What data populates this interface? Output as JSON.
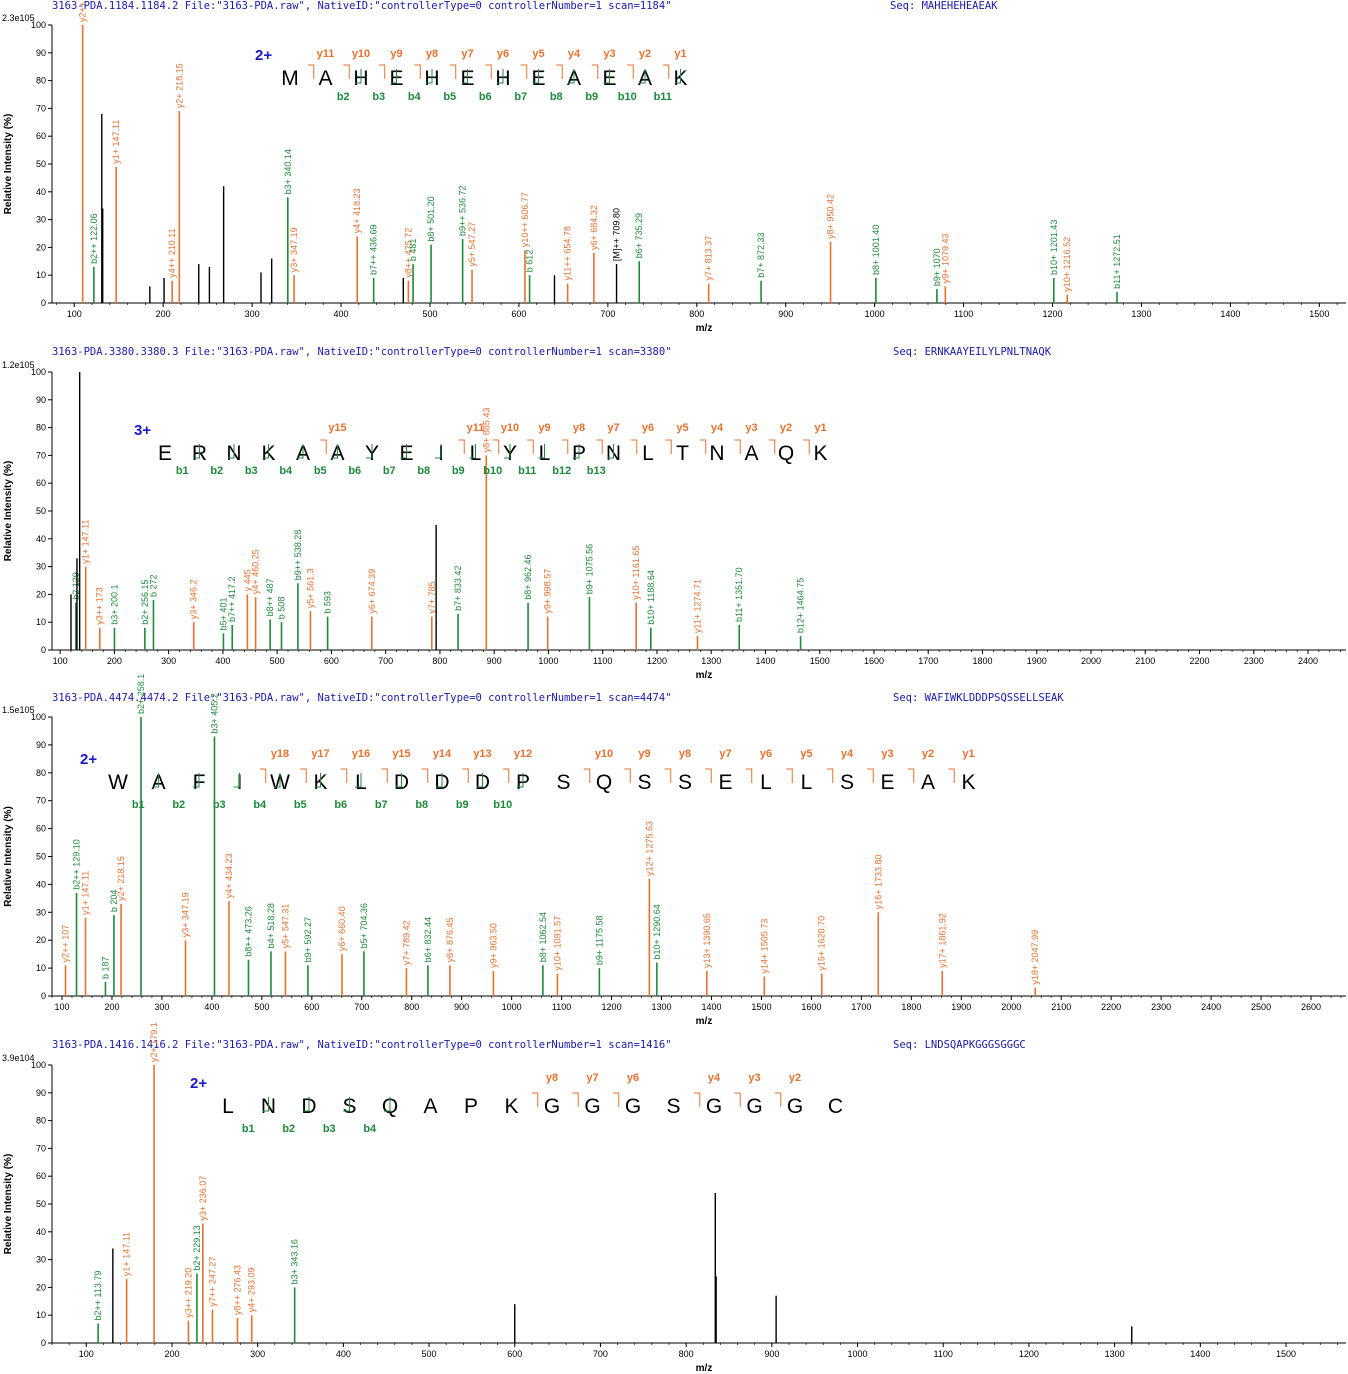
{
  "colors": {
    "y_ion": "#e8722f",
    "b_ion": "#1e8a3a",
    "b_ion_light": "#3bd13b",
    "peak": "#000000",
    "header": "#1a1aa8",
    "charge": "#1a1acc",
    "text": "#000000"
  },
  "axis": {
    "ylabel": "Relative Intensity (%)",
    "xlabel": "m/z",
    "yticks": [
      0,
      10,
      20,
      30,
      40,
      50,
      60,
      70,
      80,
      90,
      100
    ]
  },
  "chart_data": [
    {
      "type": "bar",
      "header": "3163-PDA.1184.1184.2 File:\"3163-PDA.raw\", NativeID:\"controllerType=0 controllerNumber=1 scan=1184\"",
      "seq_label": "Seq: MAHEHEHEAEAK",
      "ymax_label": "2.3e105",
      "charge": "2+",
      "sequence": [
        "M",
        "A",
        "H",
        "E",
        "H",
        "E",
        "H",
        "E",
        "A",
        "E",
        "A",
        "K"
      ],
      "y_labels": [
        "y11",
        "y10",
        "y9",
        "y8",
        "y7",
        "y6",
        "y5",
        "y4",
        "y3",
        "y2",
        "y1"
      ],
      "b_labels": [
        "b2",
        "b3",
        "b4",
        "b5",
        "b6",
        "b7",
        "b8",
        "b9",
        "b10",
        "b11"
      ],
      "xlim": [
        75,
        1530
      ],
      "xticks": [
        100,
        200,
        300,
        400,
        500,
        600,
        700,
        800,
        900,
        1000,
        1100,
        1200,
        1300,
        1400,
        1500
      ],
      "peaks": [
        {
          "mz": 109.5,
          "i": 100,
          "ion": "y",
          "label": "y2++ 109.5"
        },
        {
          "mz": 122.06,
          "i": 13,
          "ion": "b",
          "label": "b2++ 122.06"
        },
        {
          "mz": 131,
          "i": 68,
          "ion": "n"
        },
        {
          "mz": 132,
          "i": 34,
          "ion": "n"
        },
        {
          "mz": 147.11,
          "i": 49,
          "ion": "y",
          "label": "y1+ 147.11"
        },
        {
          "mz": 185,
          "i": 6,
          "ion": "n"
        },
        {
          "mz": 201,
          "i": 9,
          "ion": "n"
        },
        {
          "mz": 210.11,
          "i": 8,
          "ion": "y",
          "label": "y4++ 210.11"
        },
        {
          "mz": 218.15,
          "i": 69,
          "ion": "y",
          "label": "y2+ 218.15"
        },
        {
          "mz": 240,
          "i": 14,
          "ion": "n"
        },
        {
          "mz": 252,
          "i": 13,
          "ion": "n"
        },
        {
          "mz": 268,
          "i": 42,
          "ion": "n"
        },
        {
          "mz": 310,
          "i": 11,
          "ion": "n"
        },
        {
          "mz": 322,
          "i": 16,
          "ion": "n"
        },
        {
          "mz": 340.14,
          "i": 38,
          "ion": "b",
          "label": "b3+ 340.14"
        },
        {
          "mz": 347.19,
          "i": 10,
          "ion": "y",
          "label": "y3+ 347.19"
        },
        {
          "mz": 418.23,
          "i": 24,
          "ion": "y",
          "label": "y4+ 418.23"
        },
        {
          "mz": 436.69,
          "i": 9,
          "ion": "b",
          "label": "b7++ 436.69"
        },
        {
          "mz": 470,
          "i": 9,
          "ion": "n"
        },
        {
          "mz": 475.72,
          "i": 8,
          "ion": "y",
          "label": "y8++ 475.72"
        },
        {
          "mz": 481,
          "i": 14,
          "ion": "b",
          "label": "b 481"
        },
        {
          "mz": 501.2,
          "i": 21,
          "ion": "b",
          "label": "b8+ 501.20"
        },
        {
          "mz": 536.72,
          "i": 23,
          "ion": "b",
          "label": "b9++ 536.72"
        },
        {
          "mz": 547.27,
          "i": 12,
          "ion": "y",
          "label": "y5+ 547.27"
        },
        {
          "mz": 606.77,
          "i": 19,
          "ion": "y",
          "label": "y10++ 606.77"
        },
        {
          "mz": 612,
          "i": 10,
          "ion": "b",
          "label": "b 612"
        },
        {
          "mz": 640,
          "i": 10,
          "ion": "n"
        },
        {
          "mz": 654.78,
          "i": 7,
          "ion": "y",
          "label": "y11++ 654.78"
        },
        {
          "mz": 684.32,
          "i": 18,
          "ion": "y",
          "label": "y6+ 684.32"
        },
        {
          "mz": 709.8,
          "i": 14,
          "ion": "n",
          "label": "[M]++ 709.80"
        },
        {
          "mz": 735.29,
          "i": 15,
          "ion": "b",
          "label": "b6+ 735.29"
        },
        {
          "mz": 813.37,
          "i": 7,
          "ion": "y",
          "label": "y7+ 813.37"
        },
        {
          "mz": 872.33,
          "i": 8,
          "ion": "b",
          "label": "b7+ 872.33"
        },
        {
          "mz": 950.42,
          "i": 22,
          "ion": "y",
          "label": "y8+ 950.42"
        },
        {
          "mz": 1001.4,
          "i": 9,
          "ion": "b",
          "label": "b8+ 1001.40"
        },
        {
          "mz": 1070,
          "i": 5,
          "ion": "b",
          "label": "b9+ 1070"
        },
        {
          "mz": 1079.43,
          "i": 6,
          "ion": "y",
          "label": "y9+ 1079.43"
        },
        {
          "mz": 1201.43,
          "i": 9,
          "ion": "b",
          "label": "b10+ 1201.43"
        },
        {
          "mz": 1216.52,
          "i": 3,
          "ion": "y",
          "label": "y10+ 1216.52"
        },
        {
          "mz": 1272.51,
          "i": 4,
          "ion": "b",
          "label": "b11+ 1272.51"
        }
      ]
    },
    {
      "type": "bar",
      "header": "3163-PDA.3380.3380.3 File:\"3163-PDA.raw\", NativeID:\"controllerType=0 controllerNumber=1 scan=3380\"",
      "seq_label": "Seq: ERNKAAYEILYLPNLTNAQK",
      "ymax_label": "1.2e105",
      "charge": "3+",
      "sequence": [
        "E",
        "R",
        "N",
        "K",
        "A",
        "A",
        "Y",
        "E",
        "I",
        "L",
        "Y",
        "L",
        "P",
        "N",
        "L",
        "T",
        "N",
        "A",
        "Q",
        "K"
      ],
      "y_labels": [
        "y15",
        "y11",
        "y10",
        "y9",
        "y8",
        "y7",
        "y6",
        "y5",
        "y4",
        "y3",
        "y2",
        "y1"
      ],
      "b_labels": [
        "b1",
        "b2",
        "b3",
        "b4",
        "b5",
        "b6",
        "b7",
        "b8",
        "b9",
        "b10",
        "b11",
        "b12",
        "b13"
      ],
      "xlim": [
        85,
        2470
      ],
      "xticks": [
        100,
        200,
        300,
        400,
        500,
        600,
        700,
        800,
        900,
        1000,
        1100,
        1200,
        1300,
        1400,
        1500,
        1600,
        1700,
        1800,
        1900,
        2000,
        2100,
        2200,
        2300,
        2400
      ],
      "peaks": [
        {
          "mz": 120,
          "i": 20,
          "ion": "n"
        },
        {
          "mz": 129,
          "i": 17,
          "ion": "b",
          "label": "b2 129"
        },
        {
          "mz": 136,
          "i": 100,
          "ion": "n"
        },
        {
          "mz": 131,
          "i": 33,
          "ion": "n"
        },
        {
          "mz": 147.11,
          "i": 30,
          "ion": "y",
          "label": "y1+ 147.11"
        },
        {
          "mz": 173,
          "i": 8,
          "ion": "y",
          "label": "y3++ 173"
        },
        {
          "mz": 200.1,
          "i": 8,
          "ion": "b",
          "label": "b3+ 200.1"
        },
        {
          "mz": 256.15,
          "i": 8,
          "ion": "b",
          "label": "b2+ 256.15"
        },
        {
          "mz": 272,
          "i": 18,
          "ion": "b",
          "label": "b 272"
        },
        {
          "mz": 346.2,
          "i": 10,
          "ion": "y",
          "label": "y3+ 346.2"
        },
        {
          "mz": 401,
          "i": 6,
          "ion": "b",
          "label": "b5+ 401"
        },
        {
          "mz": 417.2,
          "i": 9,
          "ion": "b",
          "label": "b7++ 417.2"
        },
        {
          "mz": 445,
          "i": 20,
          "ion": "y",
          "label": "y 445"
        },
        {
          "mz": 460.25,
          "i": 19,
          "ion": "y",
          "label": "y4+ 460.25"
        },
        {
          "mz": 487,
          "i": 11,
          "ion": "b",
          "label": "b8++ 487"
        },
        {
          "mz": 508,
          "i": 10,
          "ion": "b",
          "label": "b 508"
        },
        {
          "mz": 538.28,
          "i": 24,
          "ion": "b",
          "label": "b9++ 538.28"
        },
        {
          "mz": 561.3,
          "i": 14,
          "ion": "y",
          "label": "y5+ 561.3"
        },
        {
          "mz": 593,
          "i": 12,
          "ion": "b",
          "label": "b 593"
        },
        {
          "mz": 674.39,
          "i": 12,
          "ion": "y",
          "label": "y6+ 674.39"
        },
        {
          "mz": 785,
          "i": 12,
          "ion": "y",
          "label": "y7+ 785"
        },
        {
          "mz": 793,
          "i": 45,
          "ion": "n"
        },
        {
          "mz": 833.42,
          "i": 13,
          "ion": "b",
          "label": "b7+ 833.42"
        },
        {
          "mz": 885.43,
          "i": 70,
          "ion": "y",
          "label": "y8+ 885.43"
        },
        {
          "mz": 962.46,
          "i": 17,
          "ion": "b",
          "label": "b8+ 962.46"
        },
        {
          "mz": 998.57,
          "i": 12,
          "ion": "y",
          "label": "y9+ 998.57"
        },
        {
          "mz": 1075.56,
          "i": 19,
          "ion": "b",
          "label": "b9+ 1075.56"
        },
        {
          "mz": 1161.65,
          "i": 17,
          "ion": "y",
          "label": "y10+ 1161.65"
        },
        {
          "mz": 1188.64,
          "i": 8,
          "ion": "b",
          "label": "b10+ 1188.64"
        },
        {
          "mz": 1274.71,
          "i": 5,
          "ion": "y",
          "label": "y11+ 1274.71"
        },
        {
          "mz": 1351.7,
          "i": 9,
          "ion": "b",
          "label": "b11+ 1351.70"
        },
        {
          "mz": 1464.75,
          "i": 5,
          "ion": "b",
          "label": "b12+ 1464.75"
        }
      ]
    },
    {
      "type": "bar",
      "header": "3163-PDA.4474.4474.2 File:\"3163-PDA.raw\", NativeID:\"controllerType=0 controllerNumber=1 scan=4474\"",
      "seq_label": "Seq: WAFIWKLDDDPSQSSELLSEAK",
      "ymax_label": "1.5e105",
      "charge": "2+",
      "sequence": [
        "W",
        "A",
        "F",
        "I",
        "W",
        "K",
        "L",
        "D",
        "D",
        "D",
        "P",
        "S",
        "Q",
        "S",
        "S",
        "E",
        "L",
        "L",
        "S",
        "E",
        "A",
        "K"
      ],
      "y_labels": [
        "y18",
        "y17",
        "y16",
        "y15",
        "y14",
        "y13",
        "y12",
        "y10",
        "y9",
        "y8",
        "y7",
        "y6",
        "y5",
        "y4",
        "y3",
        "y2",
        "y1"
      ],
      "b_labels": [
        "b1",
        "b2",
        "b3",
        "b4",
        "b5",
        "b6",
        "b7",
        "b8",
        "b9",
        "b10"
      ],
      "xlim": [
        80,
        2670
      ],
      "xticks": [
        100,
        200,
        300,
        400,
        500,
        600,
        700,
        800,
        900,
        1000,
        1100,
        1200,
        1300,
        1400,
        1500,
        1600,
        1700,
        1800,
        1900,
        2000,
        2100,
        2200,
        2300,
        2400,
        2500,
        2600
      ],
      "peaks": [
        {
          "mz": 107,
          "i": 11,
          "ion": "y",
          "label": "y2++ 107"
        },
        {
          "mz": 129.1,
          "i": 37,
          "ion": "b",
          "label": "b2++ 129.10"
        },
        {
          "mz": 147.11,
          "i": 28,
          "ion": "y",
          "label": "y1+ 147.11"
        },
        {
          "mz": 187,
          "i": 5,
          "ion": "b",
          "label": "b 187"
        },
        {
          "mz": 204,
          "i": 29,
          "ion": "b",
          "label": "b 204"
        },
        {
          "mz": 218.15,
          "i": 33,
          "ion": "y",
          "label": "y2+ 218.15"
        },
        {
          "mz": 258.1,
          "i": 100,
          "ion": "b",
          "label": "b2+ 258.1"
        },
        {
          "mz": 347.19,
          "i": 20,
          "ion": "y",
          "label": "y3+ 347.19"
        },
        {
          "mz": 405.2,
          "i": 93,
          "ion": "b",
          "label": "b3+ 405.2"
        },
        {
          "mz": 434.23,
          "i": 34,
          "ion": "y",
          "label": "y4+ 434.23"
        },
        {
          "mz": 473.26,
          "i": 13,
          "ion": "b",
          "label": "b8++ 473.26"
        },
        {
          "mz": 518.28,
          "i": 16,
          "ion": "b",
          "label": "b4+ 518.28"
        },
        {
          "mz": 547.31,
          "i": 16,
          "ion": "y",
          "label": "y5+ 547.31"
        },
        {
          "mz": 592.27,
          "i": 11,
          "ion": "b",
          "label": "b9+ 592.27"
        },
        {
          "mz": 660.4,
          "i": 15,
          "ion": "y",
          "label": "y6+ 660.40"
        },
        {
          "mz": 704.36,
          "i": 16,
          "ion": "b",
          "label": "b5+ 704.36"
        },
        {
          "mz": 789.42,
          "i": 10,
          "ion": "y",
          "label": "y7+ 789.42"
        },
        {
          "mz": 832.44,
          "i": 11,
          "ion": "b",
          "label": "b6+ 832.44"
        },
        {
          "mz": 876.45,
          "i": 11,
          "ion": "y",
          "label": "y8+ 876.45"
        },
        {
          "mz": 963.5,
          "i": 9,
          "ion": "y",
          "label": "y9+ 963.50"
        },
        {
          "mz": 1062.54,
          "i": 11,
          "ion": "b",
          "label": "b8+ 1062.54"
        },
        {
          "mz": 1091.57,
          "i": 8,
          "ion": "y",
          "label": "y10+ 1091.57"
        },
        {
          "mz": 1175.58,
          "i": 10,
          "ion": "b",
          "label": "b9+ 1175.58"
        },
        {
          "mz": 1275.63,
          "i": 42,
          "ion": "y",
          "label": "y12+ 1275.63"
        },
        {
          "mz": 1290.64,
          "i": 12,
          "ion": "b",
          "label": "b10+ 1290.64"
        },
        {
          "mz": 1390.65,
          "i": 9,
          "ion": "y",
          "label": "y13+ 1390.65"
        },
        {
          "mz": 1505.73,
          "i": 7,
          "ion": "y",
          "label": "y14+ 1505.73"
        },
        {
          "mz": 1620.7,
          "i": 8,
          "ion": "y",
          "label": "y15+ 1620.70"
        },
        {
          "mz": 1733.8,
          "i": 30,
          "ion": "y",
          "label": "y16+ 1733.80"
        },
        {
          "mz": 1861.92,
          "i": 9,
          "ion": "y",
          "label": "y17+ 1861.92"
        },
        {
          "mz": 2047.99,
          "i": 3,
          "ion": "y",
          "label": "y18+ 2047.99"
        }
      ]
    },
    {
      "type": "bar",
      "header": "3163-PDA.1416.1416.2 File:\"3163-PDA.raw\", NativeID:\"controllerType=0 controllerNumber=1 scan=1416\"",
      "seq_label": "Seq: LNDSQAPKGGGSGGGC",
      "ymax_label": "3.9e104",
      "charge": "2+",
      "sequence": [
        "L",
        "N",
        "D",
        "S",
        "Q",
        "A",
        "P",
        "K",
        "G",
        "G",
        "G",
        "S",
        "G",
        "G",
        "G",
        "C"
      ],
      "y_labels": [
        "y8",
        "y7",
        "y6",
        "y4",
        "y3",
        "y2"
      ],
      "b_labels": [
        "b1",
        "b2",
        "b3",
        "b4"
      ],
      "xlim": [
        60,
        1570
      ],
      "xticks": [
        100,
        200,
        300,
        400,
        500,
        600,
        700,
        800,
        900,
        1000,
        1100,
        1200,
        1300,
        1400,
        1500
      ],
      "peaks": [
        {
          "mz": 113.79,
          "i": 7,
          "ion": "b",
          "label": "b2++ 113.79"
        },
        {
          "mz": 131,
          "i": 34,
          "ion": "n"
        },
        {
          "mz": 147.11,
          "i": 23,
          "ion": "y",
          "label": "y1+ 147.11"
        },
        {
          "mz": 179.1,
          "i": 100,
          "ion": "y",
          "label": "y2+ 179.1"
        },
        {
          "mz": 219.2,
          "i": 8,
          "ion": "y",
          "label": "y3++ 219.20"
        },
        {
          "mz": 229.13,
          "i": 25,
          "ion": "b",
          "label": "b2+ 229.13"
        },
        {
          "mz": 236.07,
          "i": 43,
          "ion": "y",
          "label": "y3+ 236.07"
        },
        {
          "mz": 247.27,
          "i": 12,
          "ion": "y",
          "label": "y7++ 247.27"
        },
        {
          "mz": 276.43,
          "i": 9,
          "ion": "y",
          "label": "y8++ 276.43"
        },
        {
          "mz": 293.09,
          "i": 10,
          "ion": "y",
          "label": "y4+ 293.09"
        },
        {
          "mz": 343.16,
          "i": 20,
          "ion": "b",
          "label": "b3+ 343.16"
        },
        {
          "mz": 600,
          "i": 14,
          "ion": "n"
        },
        {
          "mz": 834,
          "i": 54,
          "ion": "n"
        },
        {
          "mz": 835,
          "i": 24,
          "ion": "n"
        },
        {
          "mz": 905,
          "i": 17,
          "ion": "n"
        },
        {
          "mz": 1320,
          "i": 6,
          "ion": "n"
        }
      ]
    }
  ]
}
